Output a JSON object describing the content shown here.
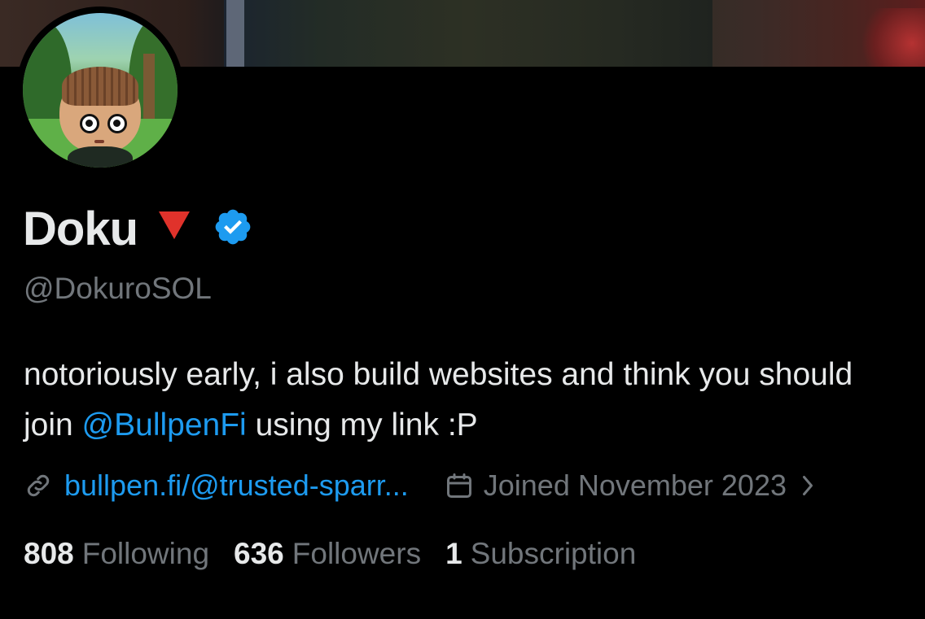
{
  "profile": {
    "display_name": "Doku",
    "handle": "@DokuroSOL",
    "emoji_icon": "red-triangle-down",
    "verified_icon": "verified-badge-icon",
    "accent_color": "#1d9bf0"
  },
  "bio": {
    "part1": "notoriously early, i also build websites and think you should join ",
    "mention": "@BullpenFi",
    "part2": " using my link :P"
  },
  "meta": {
    "link_text": "bullpen.fi/@trusted-sparr...",
    "joined_text": "Joined November 2023"
  },
  "stats": {
    "following_count": "808",
    "following_label": "Following",
    "followers_count": "636",
    "followers_label": "Followers",
    "subscription_count": "1",
    "subscription_label": "Subscription"
  },
  "colors": {
    "background": "#000000",
    "primary_text": "#e7e9ea",
    "secondary_text": "#71767b",
    "link": "#1d9bf0",
    "red_triangle": "#e0322b"
  }
}
